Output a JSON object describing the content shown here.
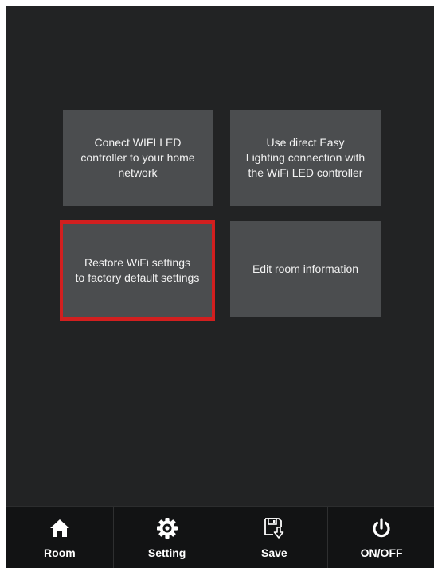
{
  "tiles": [
    {
      "label": "Conect WIFI LED\ncontroller to your home\nnetwork",
      "selected": false
    },
    {
      "label": "Use direct Easy\nLighting connection with\nthe WiFi LED controller",
      "selected": false
    },
    {
      "label": "Restore WiFi settings\nto factory default settings",
      "selected": true
    },
    {
      "label": "Edit room information",
      "selected": false
    }
  ],
  "tabbar": {
    "items": [
      {
        "label": "Room",
        "icon": "home-icon"
      },
      {
        "label": "Setting",
        "icon": "gear-icon"
      },
      {
        "label": "Save",
        "icon": "save-icon"
      },
      {
        "label": "ON/OFF",
        "icon": "power-icon"
      }
    ]
  },
  "colors": {
    "background": "#222324",
    "tile": "#4b4d4f",
    "selection_border": "#d21f1f",
    "tabbar": "#121314"
  }
}
